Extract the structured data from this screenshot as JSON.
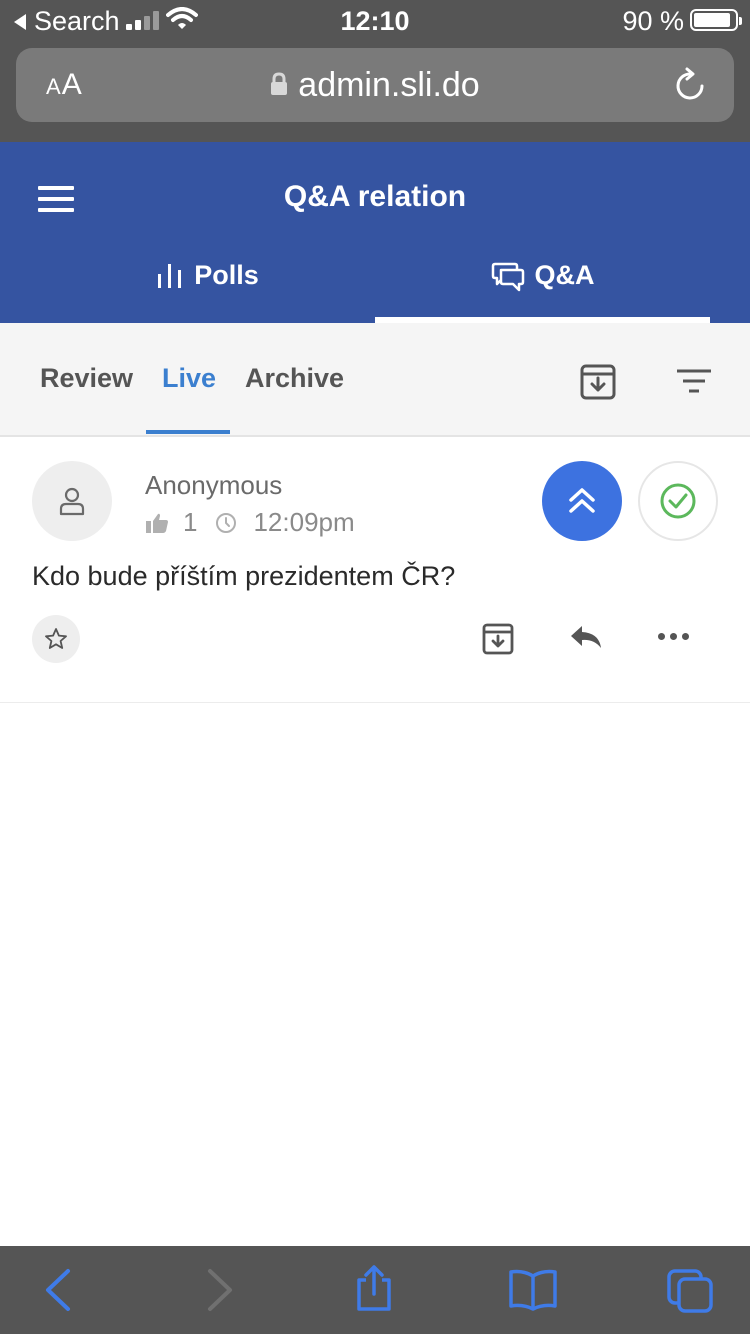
{
  "status_bar": {
    "back_label": "Search",
    "time": "12:10",
    "battery_percent": "90 %",
    "battery_level": 0.9
  },
  "url_bar": {
    "aa_label_small": "A",
    "aa_label_large": "A",
    "url": "admin.sli.do"
  },
  "app_header": {
    "title": "Q&A relation",
    "tabs": [
      {
        "label": "Polls",
        "icon": "polls-icon",
        "active": false
      },
      {
        "label": "Q&A",
        "icon": "chat-bubbles-icon",
        "active": true
      }
    ]
  },
  "sub_nav": {
    "tabs": [
      {
        "label": "Review",
        "active": false
      },
      {
        "label": "Live",
        "active": true
      },
      {
        "label": "Archive",
        "active": false
      }
    ],
    "icons": [
      "archive-all-icon",
      "filter-icon"
    ]
  },
  "question": {
    "author": "Anonymous",
    "likes": "1",
    "time": "12:09pm",
    "text": "Kdo bude příštím prezidentem ČR?",
    "icons": [
      "user-icon",
      "thumbs-up-icon",
      "clock-icon",
      "double-chevron-up-icon",
      "check-circle-icon",
      "star-icon",
      "archive-icon",
      "reply-icon",
      "more-icon"
    ]
  },
  "colors": {
    "header_blue": "#3554a1",
    "active_tab_blue": "#3b7fcf",
    "highlight_button": "#3d72e0",
    "approve_green": "#5cb85c",
    "browser_chrome": "#555555",
    "toolbar_icon_blue": "#3f7be8"
  },
  "browser_toolbar": {
    "icons": [
      "back-icon",
      "forward-icon",
      "share-icon",
      "bookmarks-icon",
      "tabs-icon"
    ]
  }
}
